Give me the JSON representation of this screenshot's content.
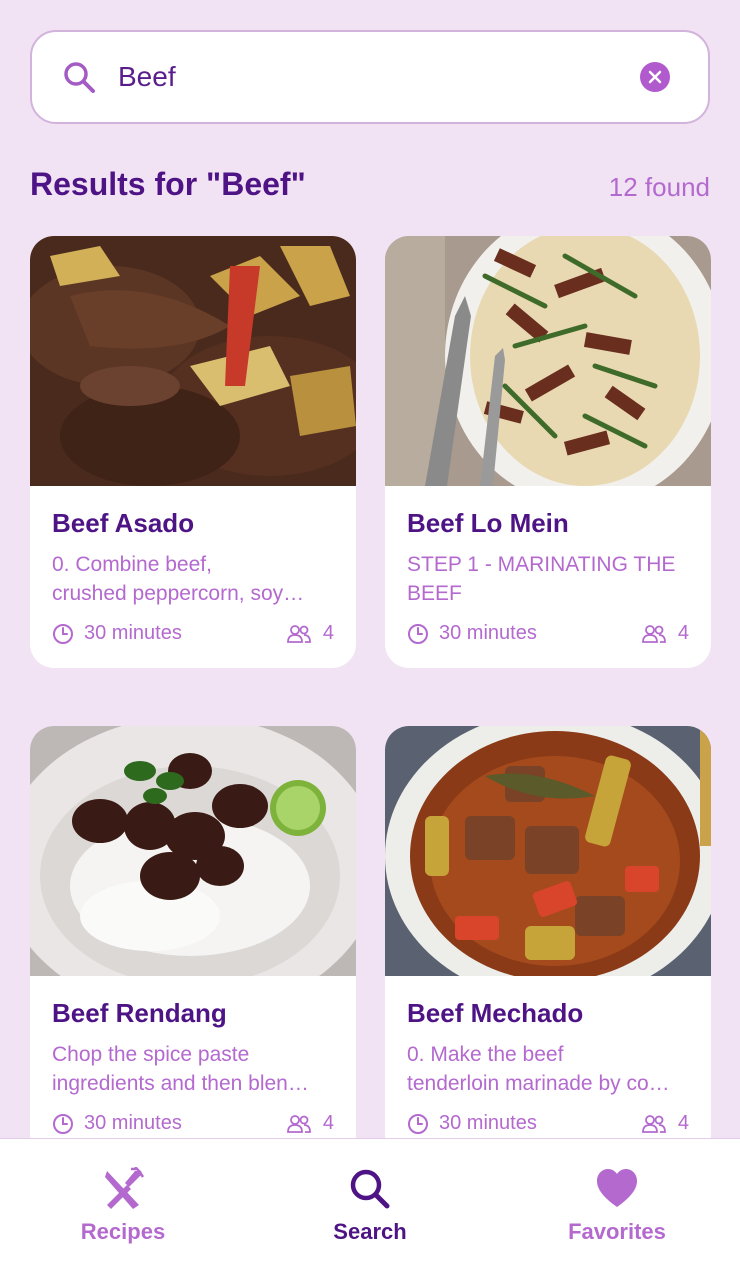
{
  "search": {
    "query": "Beef"
  },
  "results": {
    "title": "Results for \"Beef\"",
    "count": "12 found"
  },
  "recipes": [
    {
      "title": "Beef Asado",
      "desc_line1": "0.     Combine beef,",
      "desc_line2": "crushed peppercorn, soy…",
      "time": "30 minutes",
      "servings": "4"
    },
    {
      "title": "Beef Lo Mein",
      "desc_line1": "STEP 1 - MARINATING THE",
      "desc_line2": "BEEF",
      "time": "30 minutes",
      "servings": "4"
    },
    {
      "title": "Beef Rendang",
      "desc_line1": "Chop the spice paste",
      "desc_line2": "ingredients and then blen…",
      "time": "30 minutes",
      "servings": "4"
    },
    {
      "title": "Beef Mechado",
      "desc_line1": "0.     Make the beef",
      "desc_line2": "tenderloin marinade by co…",
      "time": "30 minutes",
      "servings": "4"
    }
  ],
  "tabs": [
    {
      "label": "Recipes",
      "icon": "fork-knife-icon"
    },
    {
      "label": "Search",
      "icon": "search-icon"
    },
    {
      "label": "Favorites",
      "icon": "heart-icon"
    }
  ],
  "colors": {
    "background": "#F1E3F4",
    "primary": "#4E1485",
    "accent": "#B469CF"
  }
}
